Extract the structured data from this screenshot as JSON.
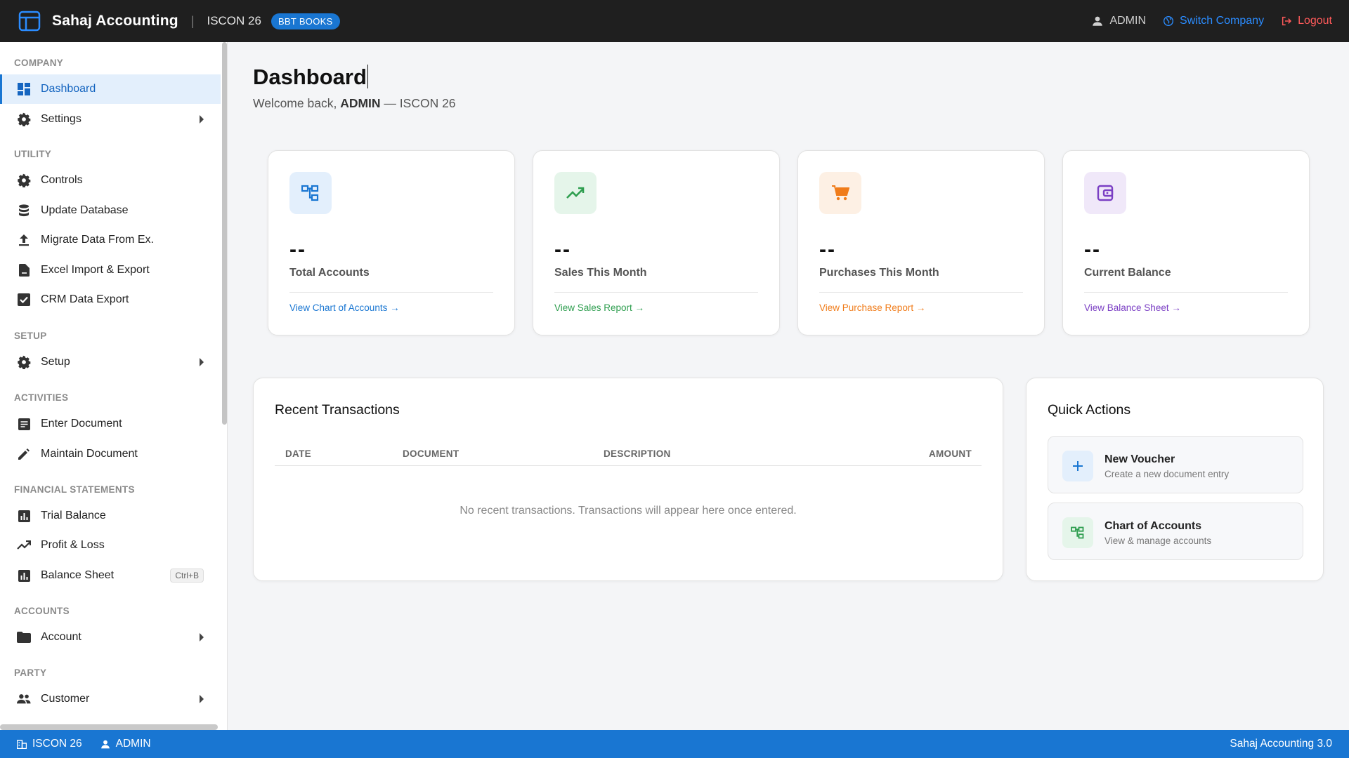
{
  "app": {
    "name": "Sahaj Accounting",
    "company": "ISCON 26",
    "badge": "BBT BOOKS"
  },
  "topbar": {
    "user": "ADMIN",
    "switch_company": "Switch Company",
    "logout": "Logout"
  },
  "sidebar": {
    "sections": [
      {
        "title": "COMPANY",
        "items": [
          {
            "label": "Dashboard",
            "icon": "dashboard-icon",
            "active": true
          },
          {
            "label": "Settings",
            "icon": "gear-icon",
            "submenu": true
          }
        ]
      },
      {
        "title": "UTILITY",
        "items": [
          {
            "label": "Controls",
            "icon": "gear-icon"
          },
          {
            "label": "Update Database",
            "icon": "database-icon"
          },
          {
            "label": "Migrate Data From Ex.",
            "icon": "upload-icon"
          },
          {
            "label": "Excel Import & Export",
            "icon": "file-icon"
          },
          {
            "label": "CRM Data Export",
            "icon": "checkbox-icon"
          }
        ]
      },
      {
        "title": "SETUP",
        "items": [
          {
            "label": "Setup",
            "icon": "gear-icon",
            "submenu": true
          }
        ]
      },
      {
        "title": "ACTIVITIES",
        "items": [
          {
            "label": "Enter Document",
            "icon": "document-icon"
          },
          {
            "label": "Maintain Document",
            "icon": "pencil-icon"
          }
        ]
      },
      {
        "title": "FINANCIAL STATEMENTS",
        "items": [
          {
            "label": "Trial Balance",
            "icon": "bar-chart-icon"
          },
          {
            "label": "Profit & Loss",
            "icon": "trend-icon"
          },
          {
            "label": "Balance Sheet",
            "icon": "bar-chart-icon",
            "shortcut": "Ctrl+B"
          }
        ]
      },
      {
        "title": "ACCOUNTS",
        "items": [
          {
            "label": "Account",
            "icon": "folder-icon",
            "submenu": true
          }
        ]
      },
      {
        "title": "PARTY",
        "items": [
          {
            "label": "Customer",
            "icon": "people-icon",
            "submenu": true
          }
        ]
      }
    ]
  },
  "main": {
    "title": "Dashboard",
    "welcome_prefix": "Welcome back,",
    "welcome_user": "ADMIN",
    "welcome_suffix": "— ISCON 26",
    "stats": [
      {
        "value": "--",
        "label": "Total Accounts",
        "link": "View Chart of Accounts →",
        "color": "#1976d2",
        "bg": "#e3effc",
        "icon": "sitemap-icon"
      },
      {
        "value": "--",
        "label": "Sales This Month",
        "link": "View Sales Report →",
        "color": "#2e9e4f",
        "bg": "#e5f5ea",
        "icon": "trending-up-icon"
      },
      {
        "value": "--",
        "label": "Purchases This Month",
        "link": "View Purchase Report →",
        "color": "#f07c1a",
        "bg": "#fdf0e4",
        "icon": "cart-icon"
      },
      {
        "value": "--",
        "label": "Current Balance",
        "link": "View Balance Sheet →",
        "color": "#7b3fc4",
        "bg": "#f0e8f9",
        "icon": "wallet-icon"
      }
    ],
    "recent": {
      "title": "Recent Transactions",
      "columns": [
        "DATE",
        "DOCUMENT",
        "DESCRIPTION",
        "AMOUNT"
      ],
      "empty": "No recent transactions. Transactions will appear here once entered."
    },
    "quick": {
      "title": "Quick Actions",
      "items": [
        {
          "title": "New Voucher",
          "desc": "Create a new document entry",
          "icon": "plus-icon"
        },
        {
          "title": "Chart of Accounts",
          "desc": "View & manage accounts",
          "icon": "sitemap-icon"
        }
      ]
    }
  },
  "statusbar": {
    "company": "ISCON 26",
    "user": "ADMIN",
    "version": "Sahaj Accounting 3.0"
  }
}
